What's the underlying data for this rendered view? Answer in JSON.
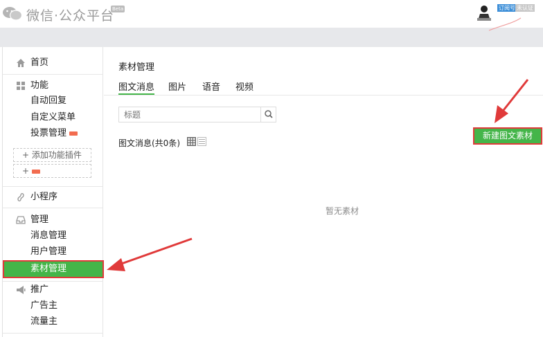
{
  "header": {
    "logo_text": "微信·公众平台",
    "beta": "Beta",
    "account_type": "订阅号",
    "verify_status": "未认证"
  },
  "sidebar": {
    "home": "首页",
    "features": "功能",
    "auto_reply": "自动回复",
    "custom_menu": "自定义菜单",
    "vote": "投票管理",
    "add_plugin": "+ 添加功能插件",
    "plus": "+",
    "mini_program": "小程序",
    "manage": "管理",
    "msg_manage": "消息管理",
    "user_manage": "用户管理",
    "material_manage": "素材管理",
    "promote": "推广",
    "advertiser": "广告主",
    "publisher": "流量主"
  },
  "main": {
    "title": "素材管理",
    "tabs": [
      "图文消息",
      "图片",
      "语音",
      "视频"
    ],
    "search_placeholder": "标题",
    "count_label": "图文消息(共0条)",
    "new_button": "新建图文素材",
    "empty_text": "暂无素材"
  },
  "colors": {
    "accent_green": "#44b549",
    "highlight_red": "#e03a3a"
  }
}
